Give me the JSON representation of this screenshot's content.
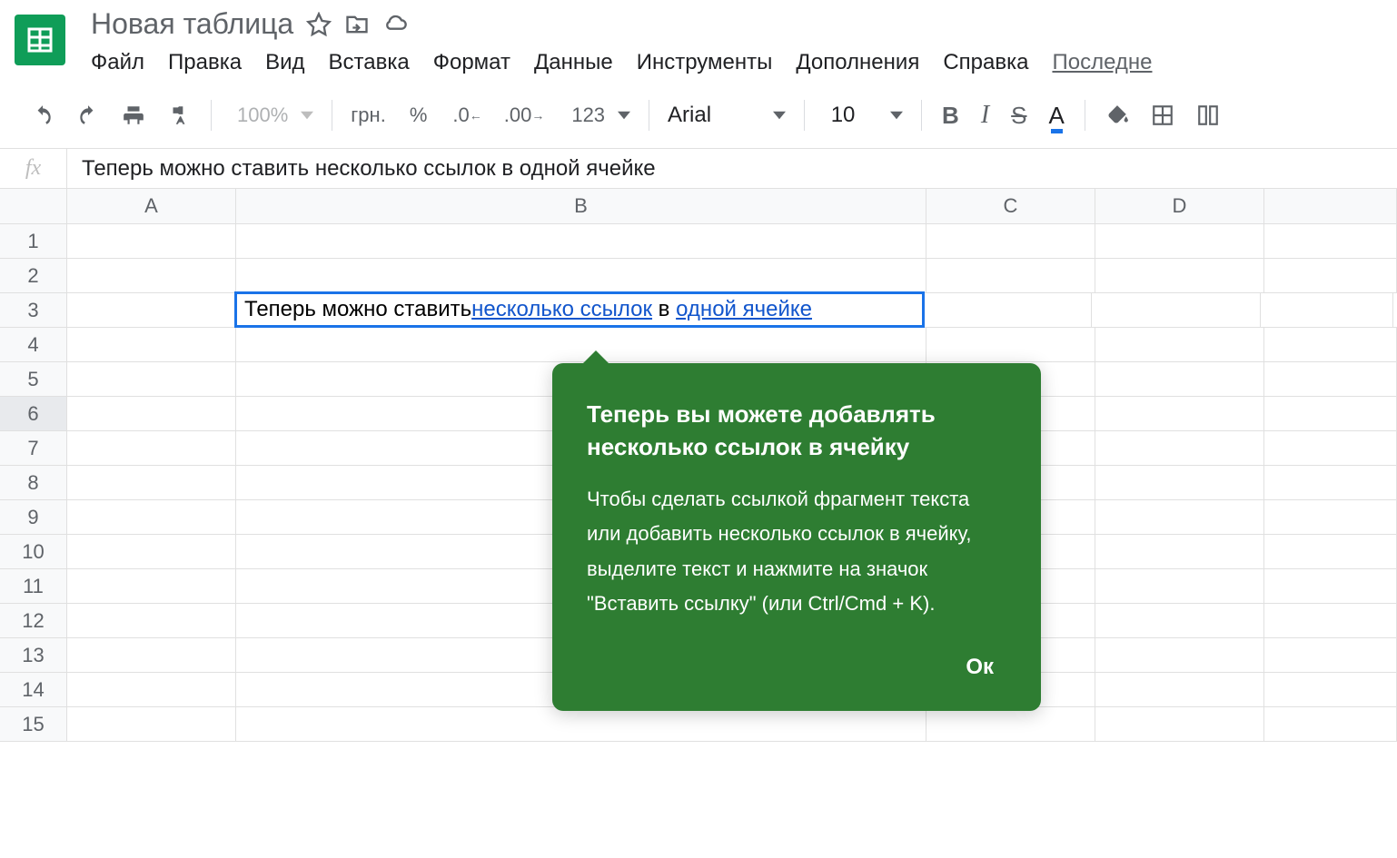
{
  "doc": {
    "title": "Новая таблица"
  },
  "menubar": [
    "Файл",
    "Правка",
    "Вид",
    "Вставка",
    "Формат",
    "Данные",
    "Инструменты",
    "Дополнения",
    "Справка",
    "Последне"
  ],
  "toolbar": {
    "zoom": "100%",
    "currency": "грн.",
    "percent": "%",
    "dec_dec": ".0",
    "dec_inc": ".00",
    "num_format": "123",
    "font": "Arial",
    "font_size": "10",
    "bold": "B",
    "italic": "I",
    "strike": "S",
    "textcolor": "A"
  },
  "formula_bar": {
    "fx": "fx",
    "content": "Теперь можно ставить несколько ссылок в одной ячейке"
  },
  "columns": [
    "A",
    "B",
    "C",
    "D"
  ],
  "rows": [
    1,
    2,
    3,
    4,
    5,
    6,
    7,
    8,
    9,
    10,
    11,
    12,
    13,
    14,
    15
  ],
  "selected_cell": {
    "prefix": "Теперь можно ставить ",
    "link1": "несколько ссылок",
    "mid": " в ",
    "link2": "одной ячейке"
  },
  "tooltip": {
    "title": "Теперь вы можете добавлять несколько ссылок в ячейку",
    "body": "Чтобы сделать ссылкой фрагмент текста или добавить несколько ссылок в ячейку, выделите текст и нажмите на значок \"Вставить ссылку\" (или Ctrl/Cmd + K).",
    "ok": "Ок"
  }
}
